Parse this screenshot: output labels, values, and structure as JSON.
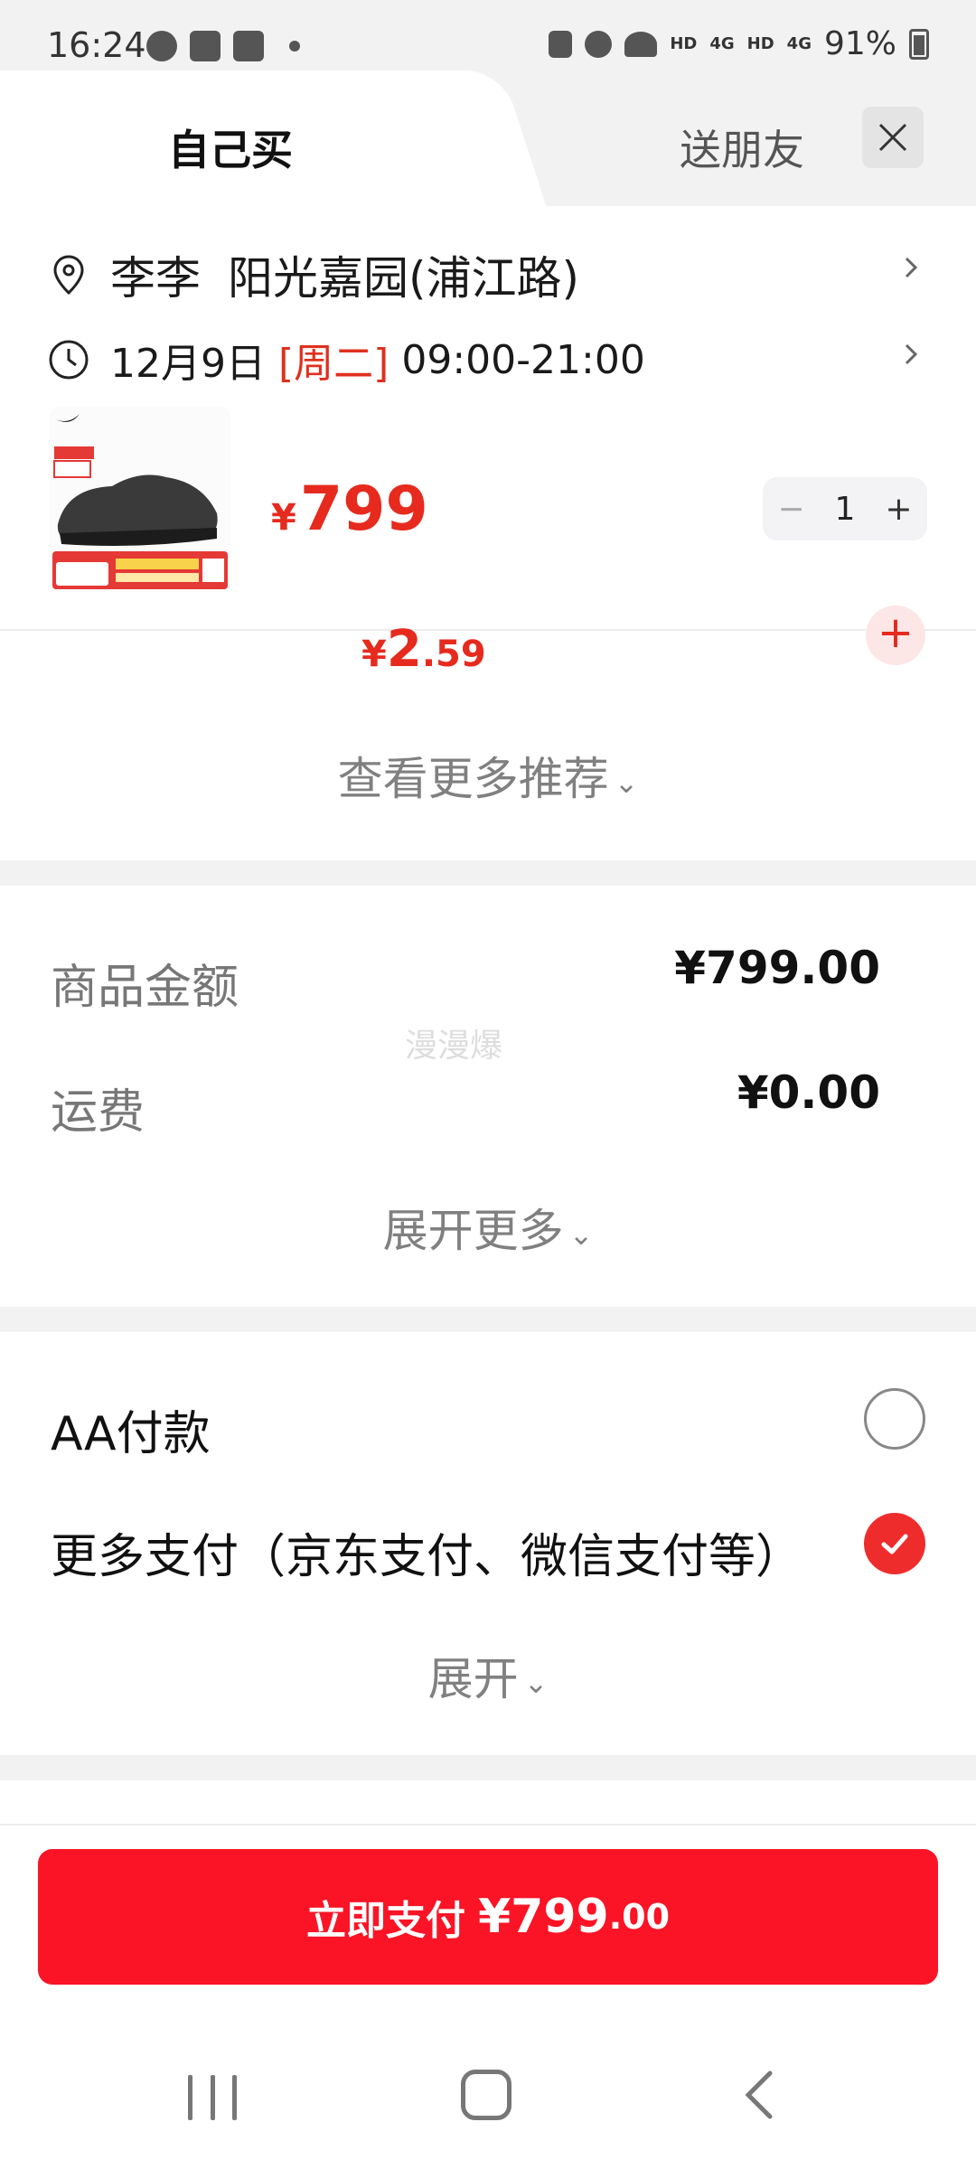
{
  "status_bar": {
    "time": "16:24",
    "signal_1": "4G",
    "hd_1": "HD",
    "signal_2": "4G",
    "hd_2": "HD",
    "battery": "91%"
  },
  "tabs": {
    "self_buy": "自己买",
    "gift": "送朋友"
  },
  "delivery": {
    "receiver": "李李",
    "address": "阳光嘉园(浦江路)",
    "date": "12月9日",
    "weekday": "[周二]",
    "time_range": "09:00-21:00"
  },
  "product": {
    "price_symbol": "¥",
    "price": "799",
    "quantity": "1",
    "minus": "−",
    "plus": "+"
  },
  "recommend": {
    "partial_price_symbol": "¥",
    "partial_price_int": "2",
    "partial_price_dec": ".59",
    "see_more": "查看更多推荐"
  },
  "summary": {
    "goods_amount_label": "商品金额",
    "goods_amount_value": "¥799.00",
    "shipping_label": "运费",
    "shipping_value": "¥0.00",
    "expand_more": "展开更多",
    "watermark": "漫漫爆"
  },
  "payment": {
    "aa_label": "AA付款",
    "more_label": "更多支付（京东支付、微信支付等）",
    "expand": "展开",
    "selected": "more"
  },
  "pay_button": {
    "label": "立即支付",
    "amount": "¥799",
    "decimals": ".00"
  },
  "colors": {
    "accent_red": "#fa1426",
    "price_red": "#e62a1e"
  }
}
